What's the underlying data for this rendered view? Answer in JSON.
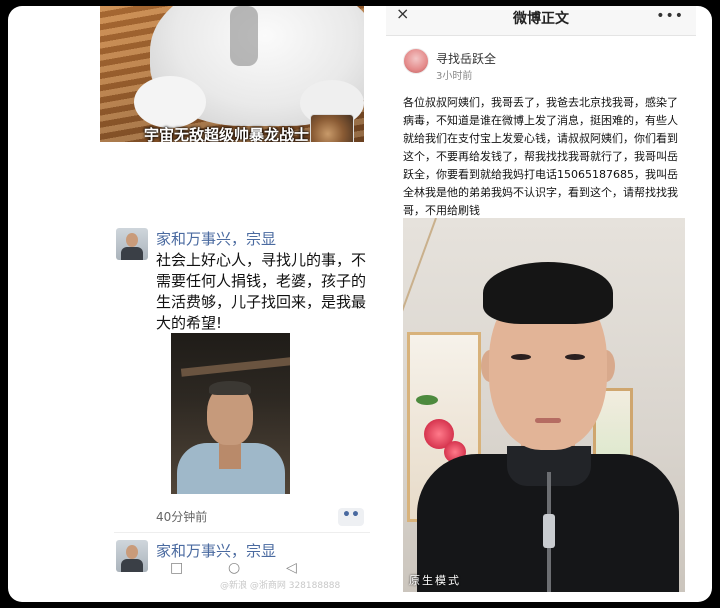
{
  "left_panel": {
    "top_post": {
      "caption": "宇宙无敌超级帅暴龙战士"
    },
    "post": {
      "author": "家和万事兴，宗显",
      "text": "社会上好心人，寻找儿的事，不需要任何人捐钱，老婆，孩子的生活费够，儿子找回来，是我最大的希望!",
      "timestamp": "40分钟前",
      "more_label": "••"
    },
    "next_post": {
      "author": "家和万事兴，宗显"
    },
    "navbar": {
      "square_icon": "square-nav-icon",
      "circle_icon": "circle-nav-icon",
      "back_icon": "triangle-back-icon"
    },
    "watermark": "@新浪 @浙商网 328188888"
  },
  "right_panel": {
    "header": {
      "back_label": "×",
      "title": "微博正文",
      "more_label": "•••"
    },
    "post": {
      "author": "寻找岳跃全",
      "time": "3小时前",
      "text": "各位叔叔阿姨们，我哥丢了，我爸去北京找我哥，感染了病毒，不知道是谁在微博上发了消息，挺困难的，有些人就给我们在支付宝上发爱心钱，请叔叔阿姨们，你们看到这个，不要再给发钱了，帮我找找我哥就行了，我哥叫岳跃全，你要看到就给我妈打电话15065187685，我叫岳全林我是他的弟弟我妈不认识字，看到这个，请帮找找我哥，不用给刷钱",
      "photo_label": "原生模式"
    }
  },
  "colors": {
    "author_link": "#4a6aa0",
    "background": "#000000",
    "panel": "#ffffff"
  }
}
